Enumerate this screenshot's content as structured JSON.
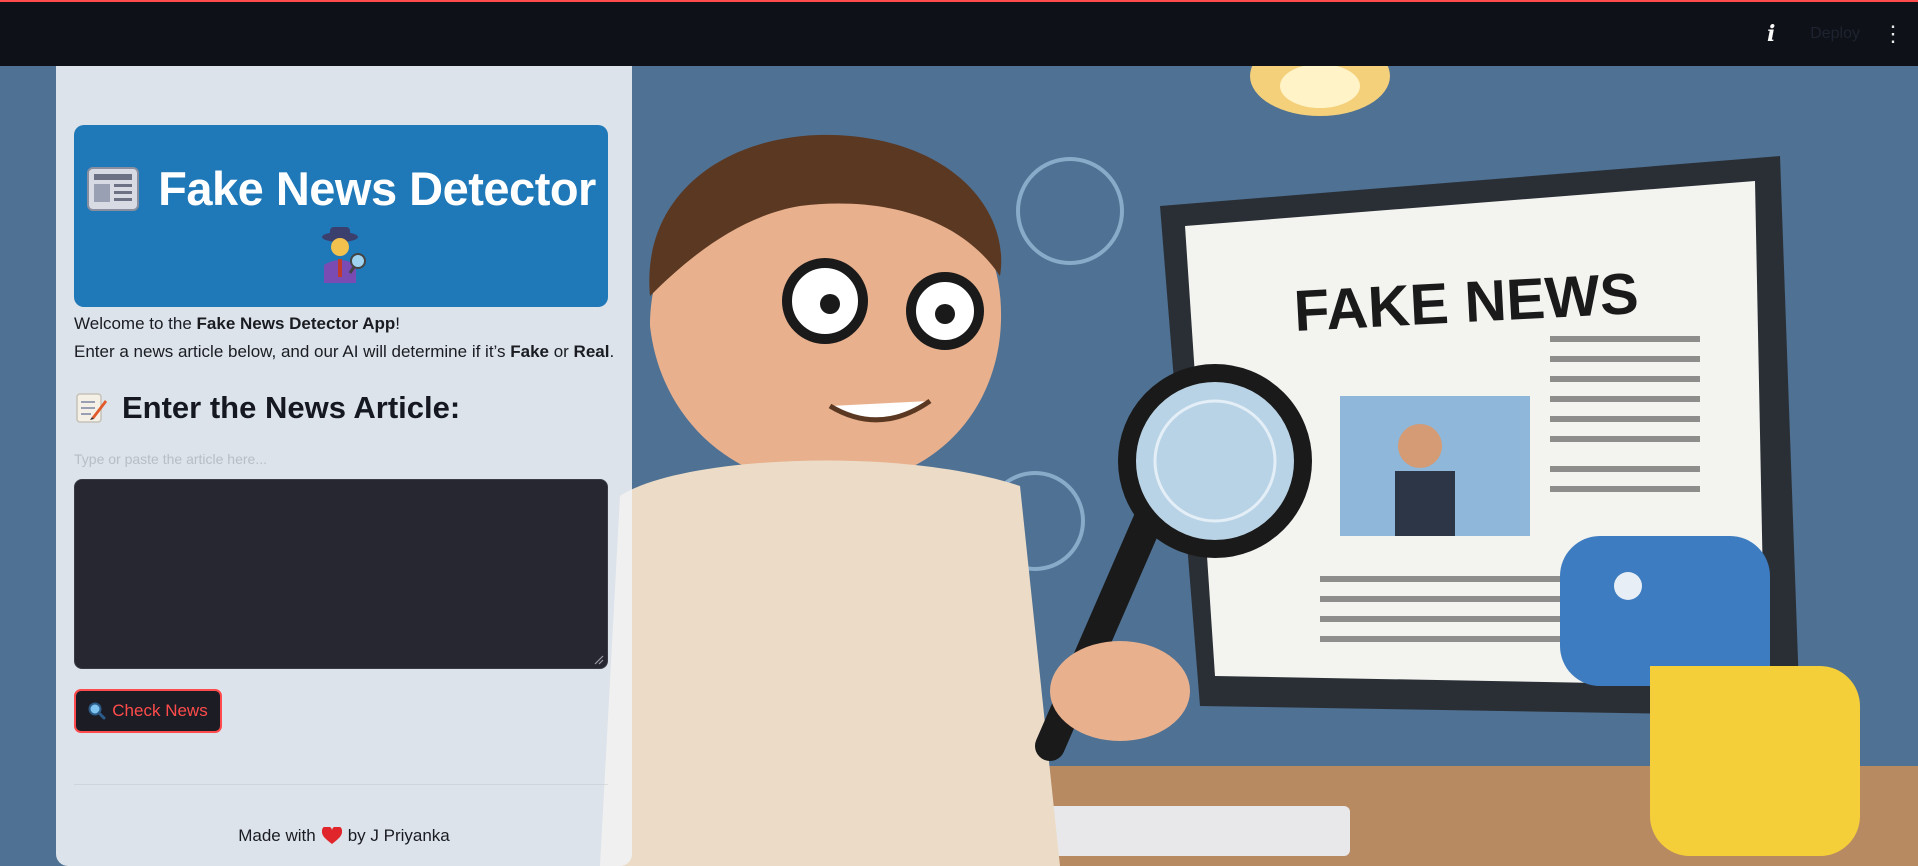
{
  "header": {
    "info_glyph": "i",
    "deploy_label": "Deploy",
    "menu_glyph": "⋮"
  },
  "banner": {
    "title": "Fake News Detector",
    "icons": [
      "newspaper-icon",
      "detective-icon"
    ]
  },
  "intro": {
    "line1_prefix": "Welcome to the ",
    "line1_bold": "Fake News Detector App",
    "line1_suffix": "!",
    "line2_prefix": "Enter a news article below, and our AI will determine if it’s ",
    "fake_word": "Fake",
    "or_word": " or ",
    "real_word": "Real",
    "line2_suffix": "."
  },
  "article": {
    "heading": "Enter the News Article:",
    "icon": "memo-icon",
    "field_label": "Type or paste the article here...",
    "value": ""
  },
  "check_button": {
    "label": "Check News",
    "icon": "magnifier-icon"
  },
  "footer": {
    "prefix": "Made with",
    "icon": "heart-icon",
    "suffix": "by J Priyanka"
  },
  "background_art": {
    "headline": "FAKE NEWS"
  },
  "colors": {
    "header_bg": "#0e1117",
    "accent": "#ff4b4b",
    "banner_bg": "#1f78b8",
    "textarea_bg": "#262730"
  }
}
